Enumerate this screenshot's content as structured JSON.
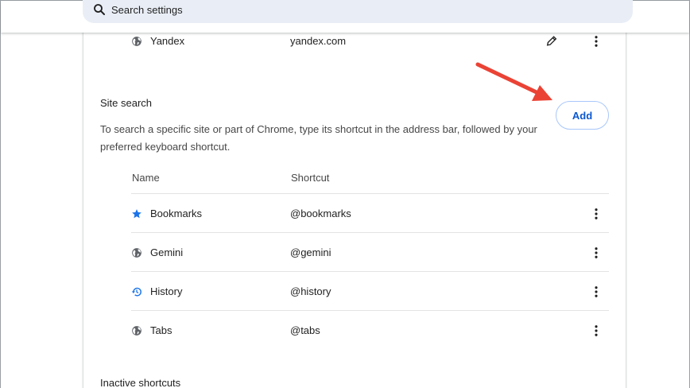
{
  "search": {
    "placeholder": "Search settings",
    "icon": "search-icon"
  },
  "top_engine": {
    "name": "Yandex",
    "shortcut": "yandex.com",
    "icon": "globe-icon"
  },
  "site_search": {
    "title": "Site search",
    "description": "To search a specific site or part of Chrome, type its shortcut in the address bar, followed by your preferred keyboard shortcut.",
    "add_label": "Add",
    "columns": {
      "name": "Name",
      "shortcut": "Shortcut"
    },
    "rows": [
      {
        "name": "Bookmarks",
        "shortcut": "@bookmarks",
        "icon": "star-icon"
      },
      {
        "name": "Gemini",
        "shortcut": "@gemini",
        "icon": "globe-icon"
      },
      {
        "name": "History",
        "shortcut": "@history",
        "icon": "history-icon"
      },
      {
        "name": "Tabs",
        "shortcut": "@tabs",
        "icon": "globe-icon"
      }
    ]
  },
  "inactive": {
    "title": "Inactive shortcuts"
  },
  "colors": {
    "accent": "#0b57d0",
    "annotation_arrow": "#ea4335",
    "search_bg": "#e9eef6",
    "star": "#1a73e8"
  }
}
